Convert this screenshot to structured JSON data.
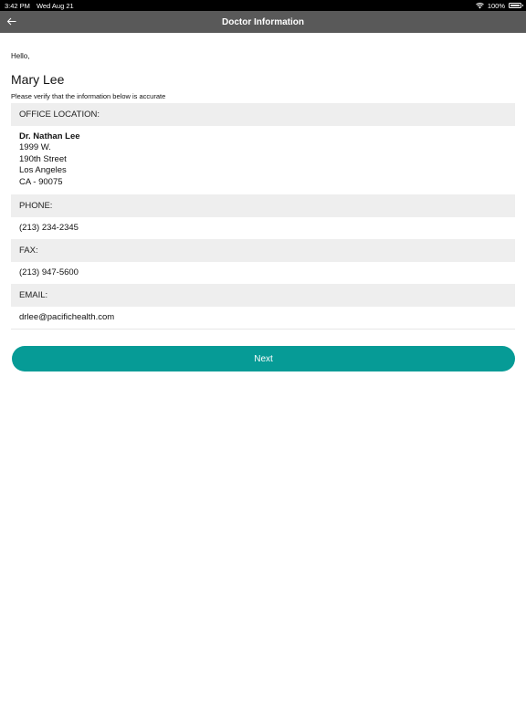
{
  "status_bar": {
    "time": "3:42 PM",
    "date": "Wed Aug 21",
    "battery_percent": "100%",
    "battery_level": 1.0,
    "wifi_icon": "wifi-icon",
    "battery_icon": "battery-icon"
  },
  "nav": {
    "title": "Doctor Information",
    "back_icon": "arrow-left-icon"
  },
  "greeting": "Hello,",
  "user_name": "Mary Lee",
  "instruction": "Please verify that the information below is accurate",
  "office": {
    "label": "OFFICE LOCATION:",
    "doctor_name": "Dr. Nathan Lee",
    "address_line1": "1999 W.",
    "address_line2": "190th Street",
    "city": "Los Angeles",
    "state_zip": "CA - 90075"
  },
  "phone": {
    "label": "PHONE:",
    "value": "(213) 234-2345"
  },
  "fax": {
    "label": "FAX:",
    "value": "(213) 947-5600"
  },
  "email": {
    "label": "EMAIL:",
    "value": "drlee@pacifichealth.com"
  },
  "next_button": {
    "label": "Next"
  },
  "colors": {
    "nav_background": "#595959",
    "section_background": "#eeeeee",
    "accent": "#069b96"
  }
}
